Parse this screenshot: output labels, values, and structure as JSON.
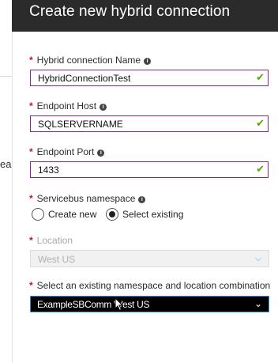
{
  "header": {
    "title": "Create new hybrid connection"
  },
  "background": {
    "fragment_text": "ea"
  },
  "fields": {
    "name": {
      "label": "Hybrid connection Name",
      "value": "HybridConnectionTest"
    },
    "host": {
      "label": "Endpoint Host",
      "value": "SQLSERVERNAME"
    },
    "port": {
      "label": "Endpoint Port",
      "value": "1433"
    },
    "namespace": {
      "label": "Servicebus namespace",
      "options": [
        "Create new",
        "Select existing"
      ],
      "selected": "Select existing"
    },
    "location": {
      "label": "Location",
      "value": "West US"
    },
    "existing": {
      "label": "Select an existing namespace and location combination",
      "value": "ExampleSBComm West US"
    }
  },
  "colors": {
    "header_bg": "#2b2b2b",
    "input_border": "#7f2a8c",
    "valid_check": "#57a300",
    "required_asterisk": "#c8102e",
    "dropdown_focus_border": "#3d8bd0"
  },
  "icons": {
    "info": "info-icon",
    "valid": "checkmark-icon",
    "dropdown": "chevron-down-icon",
    "cursor": "mouse-pointer-icon"
  }
}
